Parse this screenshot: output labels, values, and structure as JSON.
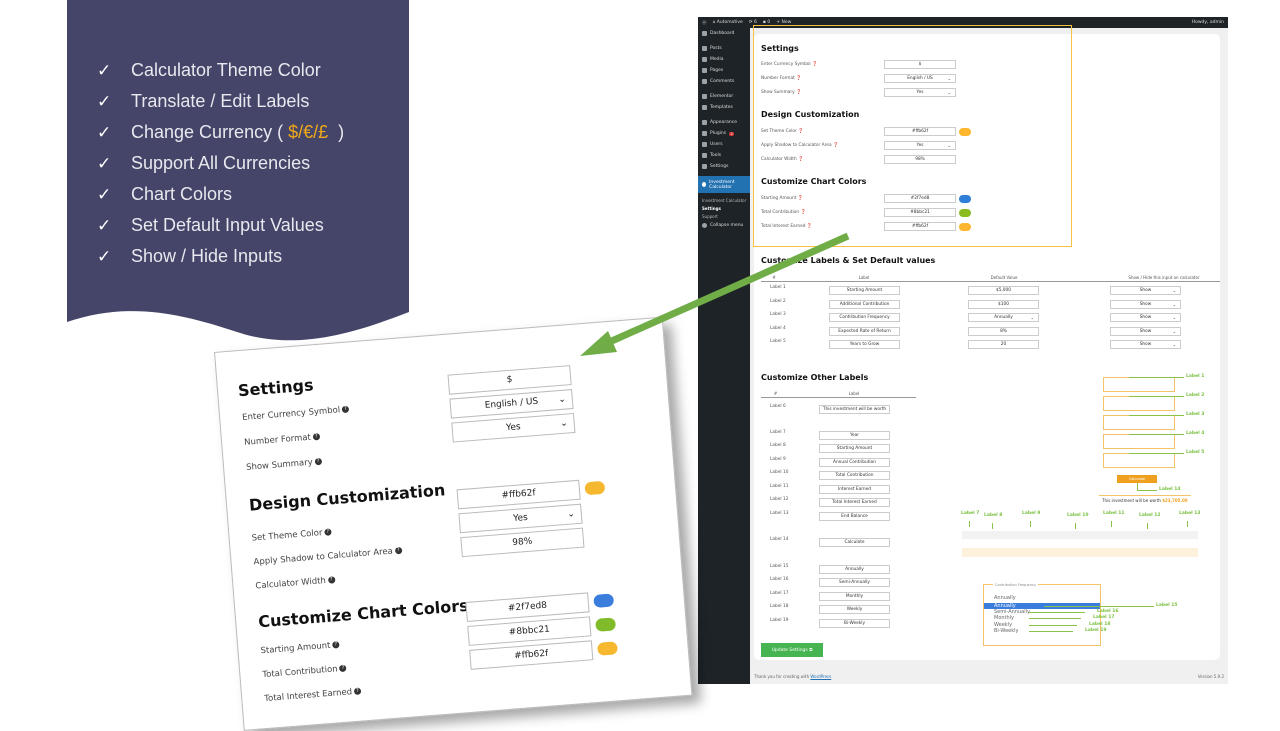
{
  "features": {
    "items": [
      "Calculator Theme Color",
      "Translate / Edit Labels",
      "Change Currency (",
      "Support All Currencies",
      "Chart Colors",
      "Set Default Input Values",
      "Show / Hide Inputs"
    ],
    "currency_symbols": "$/€/£",
    "currency_close": ")",
    "check_icon": "✓"
  },
  "wp": {
    "topbar": {
      "site": "Automotive",
      "updates": "6",
      "comments": "0",
      "new": "New",
      "greeting": "Howdy, admin"
    },
    "sidebar": [
      {
        "label": "Dashboard"
      },
      {
        "label": "Posts"
      },
      {
        "label": "Media"
      },
      {
        "label": "Pages"
      },
      {
        "label": "Comments"
      },
      {
        "label": "Elementor"
      },
      {
        "label": "Templates"
      },
      {
        "label": "Appearance"
      },
      {
        "label": "Plugins",
        "badge": "2"
      },
      {
        "label": "Users"
      },
      {
        "label": "Tools"
      },
      {
        "label": "Settings"
      },
      {
        "label": "Investment Calculator"
      }
    ],
    "submenu": [
      "Investment Calculator",
      "Settings",
      "Support"
    ],
    "collapse": "Collapse menu",
    "settings": {
      "title": "Settings",
      "currency_label": "Enter Currency Symbol",
      "currency_value": "$",
      "format_label": "Number Format",
      "format_value": "English / US",
      "summary_label": "Show Summary",
      "summary_value": "Yes"
    },
    "design": {
      "title": "Design Customization",
      "theme_label": "Set Theme Color",
      "theme_value": "#ffb62f",
      "theme_color": "#ffb62f",
      "shadow_label": "Apply Shadow to Calculator Area",
      "shadow_value": "Yes",
      "width_label": "Calculator Width",
      "width_value": "98%"
    },
    "chart_colors": {
      "title": "Customize Chart Colors",
      "items": [
        {
          "label": "Starting Amount",
          "value": "#2f7ed8",
          "color": "#2f7ed8"
        },
        {
          "label": "Total Contribution",
          "value": "#8bbc21",
          "color": "#8bbc21"
        },
        {
          "label": "Total Interest Earned",
          "value": "#ffb62f",
          "color": "#ffb62f"
        }
      ]
    },
    "labels_defaults": {
      "title": "Customize Labels & Set Default values",
      "headers": [
        "#",
        "Label",
        "Default Value",
        "Show / Hide this input on calculator"
      ],
      "rows": [
        {
          "num": "Label 1",
          "label": "Starting Amount",
          "default": "$5,000",
          "show": "Show"
        },
        {
          "num": "Label 2",
          "label": "Additional Contribution",
          "default": "$100",
          "show": "Show"
        },
        {
          "num": "Label 3",
          "label": "Contribution Frequency",
          "default": "Annually",
          "show": "Show"
        },
        {
          "num": "Label 4",
          "label": "Expected Rate of Return",
          "default": "8%",
          "show": "Show"
        },
        {
          "num": "Label 5",
          "label": "Years to Grow",
          "default": "20",
          "show": "Show"
        }
      ]
    },
    "other_labels": {
      "title": "Customize Other Labels",
      "headers": [
        "#",
        "Label"
      ],
      "rows": [
        {
          "num": "Label 6",
          "label": "This investment will be worth"
        },
        {
          "num": "Label 7",
          "label": "Year"
        },
        {
          "num": "Label 8",
          "label": "Starting Amount"
        },
        {
          "num": "Label 9",
          "label": "Annual Contribution"
        },
        {
          "num": "Label 10",
          "label": "Total Contribution"
        },
        {
          "num": "Label 11",
          "label": "Interest Earned"
        },
        {
          "num": "Label 12",
          "label": "Total Interest Earned"
        },
        {
          "num": "Label 13",
          "label": "End Balance"
        },
        {
          "num": "Label 14",
          "label": "Calculate"
        },
        {
          "num": "Label 15",
          "label": "Annually"
        },
        {
          "num": "Label 16",
          "label": "Semi-Annually"
        },
        {
          "num": "Label 17",
          "label": "Monthly"
        },
        {
          "num": "Label 18",
          "label": "Weekly"
        },
        {
          "num": "Label 19",
          "label": "Bi-Weekly"
        }
      ]
    },
    "preview": {
      "callouts": [
        "Label 1",
        "Label 2",
        "Label 3",
        "Label 4",
        "Label 5"
      ],
      "calc_button": "Calculate",
      "calc_callout": "Label 14",
      "worth_text": "This investment will be worth",
      "worth_value": "$23,705.00",
      "table_callouts": [
        "Label 7",
        "Label 8",
        "Label 9",
        "Label 10",
        "Label 11",
        "Label 12",
        "Label 13"
      ],
      "freq_legend": "Contribution Frequency",
      "freq_selected": "Annually",
      "freq_options": [
        "Annually",
        "Semi-Annually",
        "Monthly",
        "Weekly",
        "Bi-Weekly"
      ],
      "freq_callouts": [
        "Label 15",
        "Label 16",
        "Label 17",
        "Label 18",
        "Label 19"
      ]
    },
    "update_button": "Update Settings",
    "footer_text": "Thank you for creating with",
    "footer_link": "WordPress",
    "version": "Version 5.9.2"
  }
}
